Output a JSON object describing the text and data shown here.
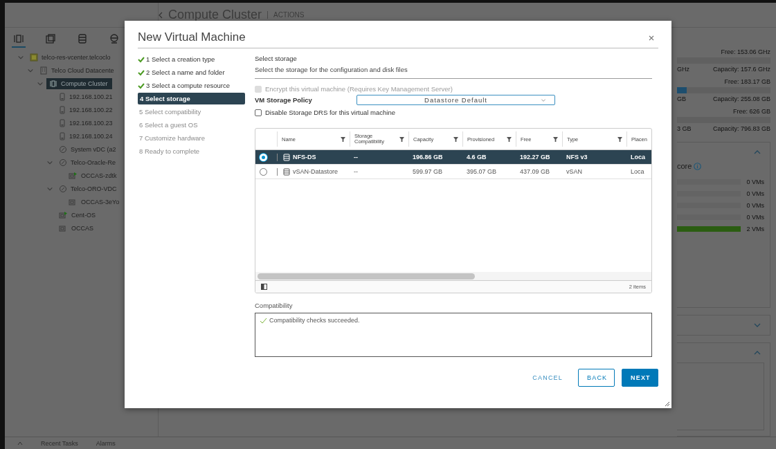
{
  "header": {
    "title": "Compute Cluster",
    "actions": "ACTIONS"
  },
  "nav_tabs": [
    {
      "kind": "hosts",
      "selected": true
    },
    {
      "kind": "vms",
      "selected": false
    },
    {
      "kind": "storage",
      "selected": false
    },
    {
      "kind": "network",
      "selected": false
    }
  ],
  "tree": [
    {
      "label": "telco-res-vcenter.telcoclo",
      "kind": "vcenter",
      "expanded": true,
      "selected": false,
      "children": [
        {
          "label": "Telco Cloud Datacente",
          "kind": "datacenter",
          "expanded": true,
          "selected": false,
          "children": [
            {
              "label": "Compute Cluster",
              "kind": "cluster",
              "expanded": true,
              "selected": true,
              "children": [
                {
                  "label": "192.168.100.21",
                  "kind": "host",
                  "selected": false
                },
                {
                  "label": "192.168.100.22",
                  "kind": "host",
                  "selected": false
                },
                {
                  "label": "192.168.100.23",
                  "kind": "host",
                  "selected": false
                },
                {
                  "label": "192.168.100.24",
                  "kind": "host",
                  "selected": false
                },
                {
                  "label": "System vDC (a2",
                  "kind": "pool",
                  "selected": false
                },
                {
                  "label": "Telco-Oracle-Re",
                  "kind": "pool",
                  "expanded": true,
                  "selected": false,
                  "children": [
                    {
                      "label": "OCCAS-zdtk",
                      "kind": "vm",
                      "powered_on": true,
                      "selected": false
                    }
                  ]
                },
                {
                  "label": "Telco-ORO-VDC",
                  "kind": "pool",
                  "expanded": true,
                  "selected": false,
                  "children": [
                    {
                      "label": "OCCAS-3eYo",
                      "kind": "vm",
                      "powered_on": false,
                      "selected": false
                    }
                  ]
                },
                {
                  "label": "Cent-OS",
                  "kind": "vm",
                  "powered_on": true,
                  "selected": false
                },
                {
                  "label": "OCCAS",
                  "kind": "vm",
                  "powered_on": false,
                  "selected": false
                }
              ]
            }
          ]
        }
      ]
    }
  ],
  "right_panel": {
    "resources": [
      {
        "free": "Free: 153.06 GHz",
        "used": "GHz",
        "capacity": "Capacity: 157.6 GHz",
        "level": 0
      },
      {
        "free": "Free: 183.17 GB",
        "used": "GB",
        "capacity": "Capacity: 255.08 GB",
        "level": 0.1
      },
      {
        "free": "Free: 626 GB",
        "used": "3 GB",
        "capacity": "Capacity: 796.83 GB",
        "level": 0
      }
    ],
    "cards": [
      {
        "expanded": true,
        "heading": "core",
        "bars": [
          {
            "reading": "0 VMs",
            "level": 0
          },
          {
            "reading": "0 VMs",
            "level": 0
          },
          {
            "reading": "0 VMs",
            "level": 0
          },
          {
            "reading": "0 VMs",
            "level": 0
          },
          {
            "reading": "2 VMs",
            "level": 1
          }
        ]
      },
      {
        "expanded": false
      },
      {
        "expanded": true
      }
    ]
  },
  "bottom_tabs": [
    "Recent Tasks",
    "Alarms"
  ],
  "dialog": {
    "title": "New Virtual Machine",
    "steps": [
      {
        "label": "1 Select a creation type",
        "done": true,
        "selected": false
      },
      {
        "label": "2 Select a name and folder",
        "done": true,
        "selected": false
      },
      {
        "label": "3 Select a compute resource",
        "done": true,
        "selected": false
      },
      {
        "label": "4 Select storage",
        "done": false,
        "selected": true
      },
      {
        "label": "5 Select compatibility",
        "done": false,
        "selected": false
      },
      {
        "label": "6 Select a guest OS",
        "done": false,
        "selected": false
      },
      {
        "label": "7 Customize hardware",
        "done": false,
        "selected": false
      },
      {
        "label": "8 Ready to complete",
        "done": false,
        "selected": false
      }
    ],
    "section_title": "Select storage",
    "description": "Select the storage for the configuration and disk files",
    "encrypt": {
      "label": "Encrypt this virtual machine (Requires Key Management Server)",
      "checked": false,
      "disabled": true
    },
    "policy": {
      "label": "VM Storage Policy",
      "value": "Datastore Default"
    },
    "disable_drs": {
      "label": "Disable Storage DRS for this virtual machine",
      "checked": false,
      "disabled": false
    },
    "table": {
      "columns": [
        "Name",
        "Storage Compatibility",
        "Capacity",
        "Provisioned",
        "Free",
        "Type",
        "Placen"
      ],
      "rows": [
        {
          "selected": true,
          "cells": [
            "NFS-DS",
            "--",
            "196.86 GB",
            "4.6 GB",
            "192.27 GB",
            "NFS v3",
            "Loca"
          ]
        },
        {
          "selected": false,
          "cells": [
            "vSAN-Datastore",
            "--",
            "599.97 GB",
            "395.07 GB",
            "437.09 GB",
            "vSAN",
            "Loca"
          ]
        }
      ],
      "footer": "2 items"
    },
    "compatibility": {
      "label": "Compatibility",
      "message": "Compatibility checks succeeded."
    },
    "buttons": [
      {
        "label": "CANCEL",
        "kind": "link"
      },
      {
        "label": "BACK",
        "kind": "outline"
      },
      {
        "label": "NEXT",
        "kind": "primary"
      }
    ]
  }
}
